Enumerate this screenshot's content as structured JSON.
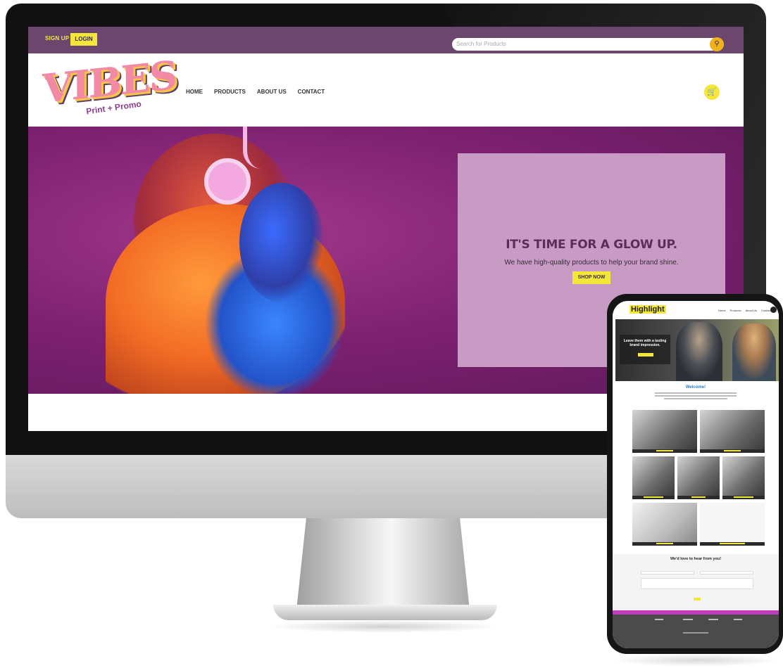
{
  "desktop": {
    "topbar": {
      "signup_label": "SIGN UP",
      "login_label": "LOGIN",
      "search_placeholder": "Search for Products",
      "search_icon": "search-icon"
    },
    "header": {
      "logo_text": "VIBES",
      "logo_sub": "Print + Promo",
      "nav": [
        "HOME",
        "PRODUCTS",
        "ABOUT US",
        "CONTACT"
      ],
      "cart_icon": "cart-icon"
    },
    "hero": {
      "title": "IT'S TIME FOR A GLOW UP.",
      "subtitle": "We have high-quality products to help your brand shine.",
      "button_label": "SHOP NOW"
    },
    "colors": {
      "topbar": "#6b466d",
      "hero_bg": "#7d2070",
      "cta_box": "#c89bc4",
      "accent_yellow": "#f5e63a",
      "search_btn": "#f0b21b"
    }
  },
  "phone": {
    "logo_text": "Highlight",
    "nav": [
      "Home",
      "Products",
      "About Us",
      "Contact"
    ],
    "hero_text": "Leave them with a lasting brand impression.",
    "welcome_title": "Welcome!",
    "contact_title": "We'd love to hear from you!"
  }
}
